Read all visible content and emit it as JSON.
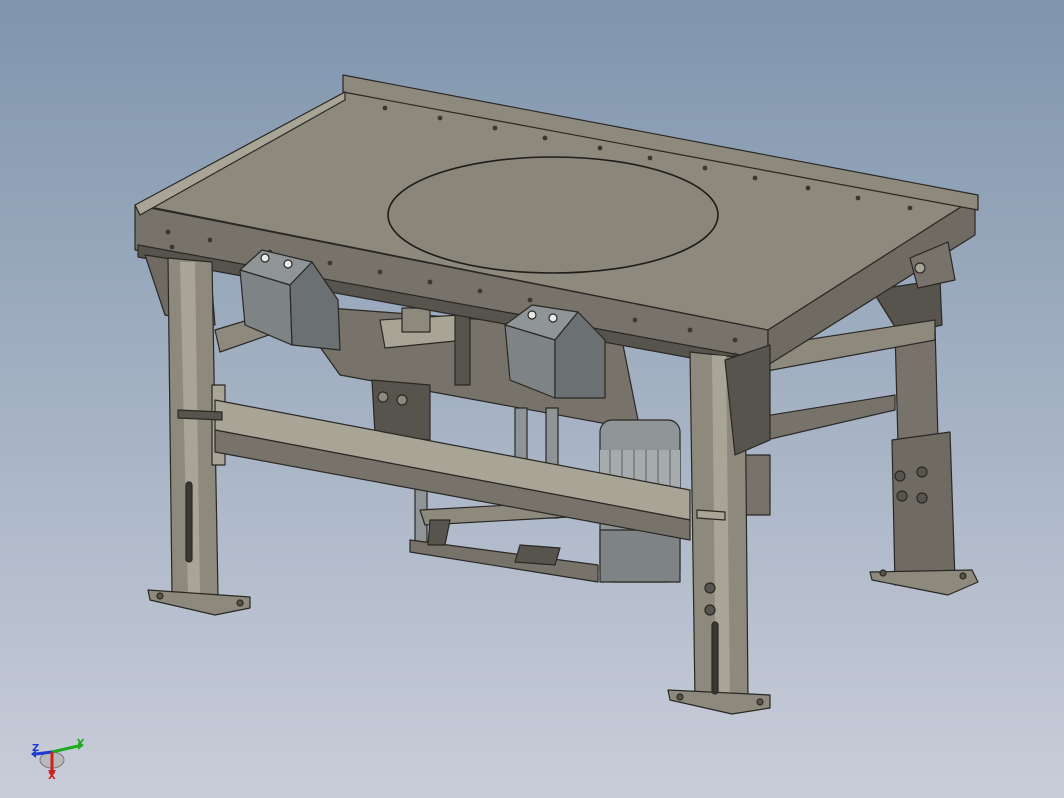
{
  "colors": {
    "bg_top": "#7f95ad",
    "bg_bottom": "#c9cdd9",
    "metal_top": "#8d897c",
    "metal_mid": "#77736a",
    "metal_dark": "#57544d",
    "metal_light": "#a8a597",
    "edge": "#2a2824",
    "motor": "#8f9496",
    "axis_x": "#d11f1f",
    "axis_y": "#1faa1f",
    "axis_z": "#1f3ad1"
  },
  "viewport": {
    "model_name": "vibrating-table-assembly",
    "icon": "3d-model-icon"
  },
  "triad": {
    "icon": "coordinate-triad-icon",
    "labels": {
      "x": "X",
      "y": "Y",
      "z": "Z"
    }
  }
}
